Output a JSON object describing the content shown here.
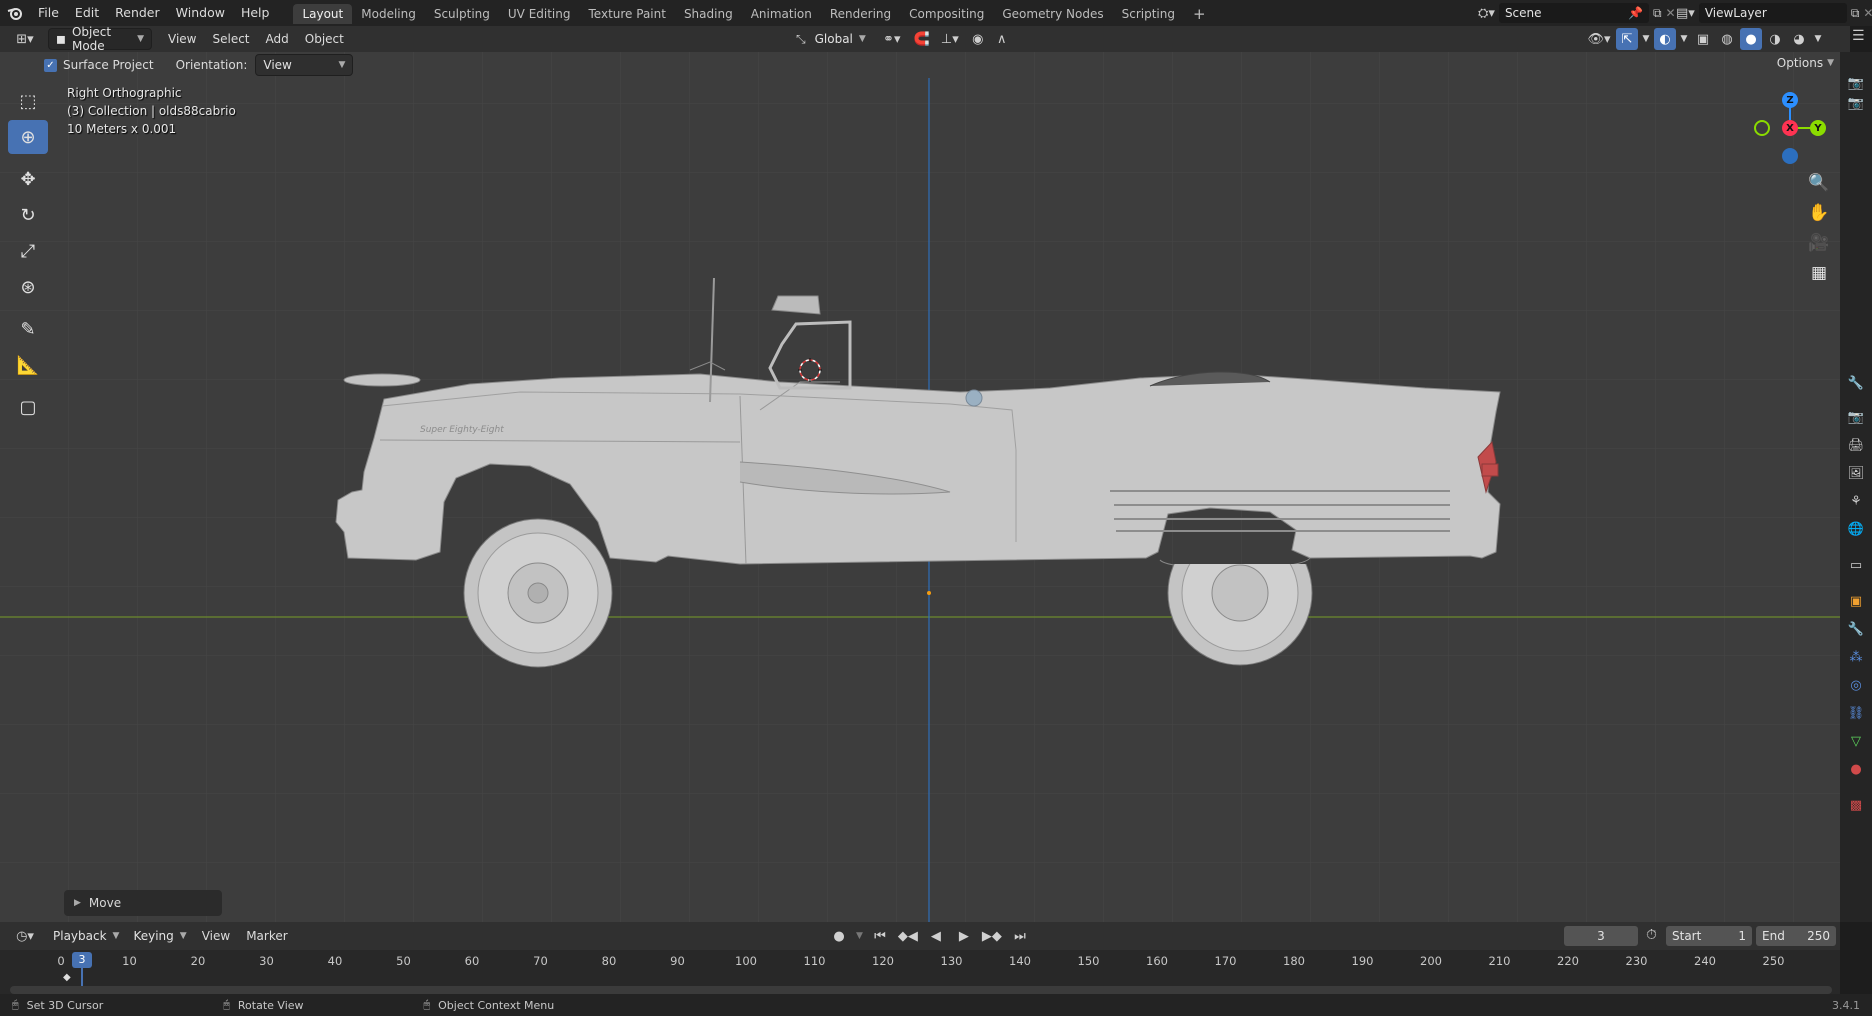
{
  "topbar": {
    "menus": [
      "File",
      "Edit",
      "Render",
      "Window",
      "Help"
    ],
    "workspaces": [
      "Layout",
      "Modeling",
      "Sculpting",
      "UV Editing",
      "Texture Paint",
      "Shading",
      "Animation",
      "Rendering",
      "Compositing",
      "Geometry Nodes",
      "Scripting"
    ],
    "active_workspace": "Layout",
    "add_workspace": "+",
    "scene": "Scene",
    "view_layer": "ViewLayer"
  },
  "header": {
    "mode": "Object Mode",
    "menus": [
      "View",
      "Select",
      "Add",
      "Object"
    ],
    "transform_orientation": "Global",
    "options": "Options"
  },
  "tool_settings": {
    "surface_project_label": "Surface Project",
    "orientation_label": "Orientation:",
    "orientation_value": "View"
  },
  "viewport": {
    "view_name": "Right Orthographic",
    "collection": "(3) Collection | olds88cabrio",
    "scale": "10 Meters x 0.001",
    "model_script": "Super Eighty-Eight"
  },
  "gizmo": {
    "z": "Z",
    "x": "X",
    "y": "Y"
  },
  "last_operator": {
    "label": "Move",
    "icon": "chevron-right-icon"
  },
  "timeline": {
    "menus": [
      "Playback",
      "Keying",
      "View",
      "Marker"
    ],
    "current_frame": "3",
    "start_label": "Start",
    "start_value": "1",
    "end_label": "End",
    "end_value": "250",
    "ticks": [
      "0",
      "10",
      "20",
      "30",
      "40",
      "50",
      "60",
      "70",
      "80",
      "90",
      "100",
      "110",
      "120",
      "130",
      "140",
      "150",
      "160",
      "170",
      "180",
      "190",
      "200",
      "210",
      "220",
      "230",
      "240",
      "250"
    ],
    "frame_marker": "3"
  },
  "status": {
    "left": "Set 3D Cursor",
    "middle": "Rotate View",
    "right": "Object Context Menu",
    "version": "3.4.1"
  },
  "colors": {
    "accent": "#4772b3",
    "axis_x": "#ff3352",
    "axis_y": "#8bdc00",
    "axis_z": "#2c8fff"
  }
}
